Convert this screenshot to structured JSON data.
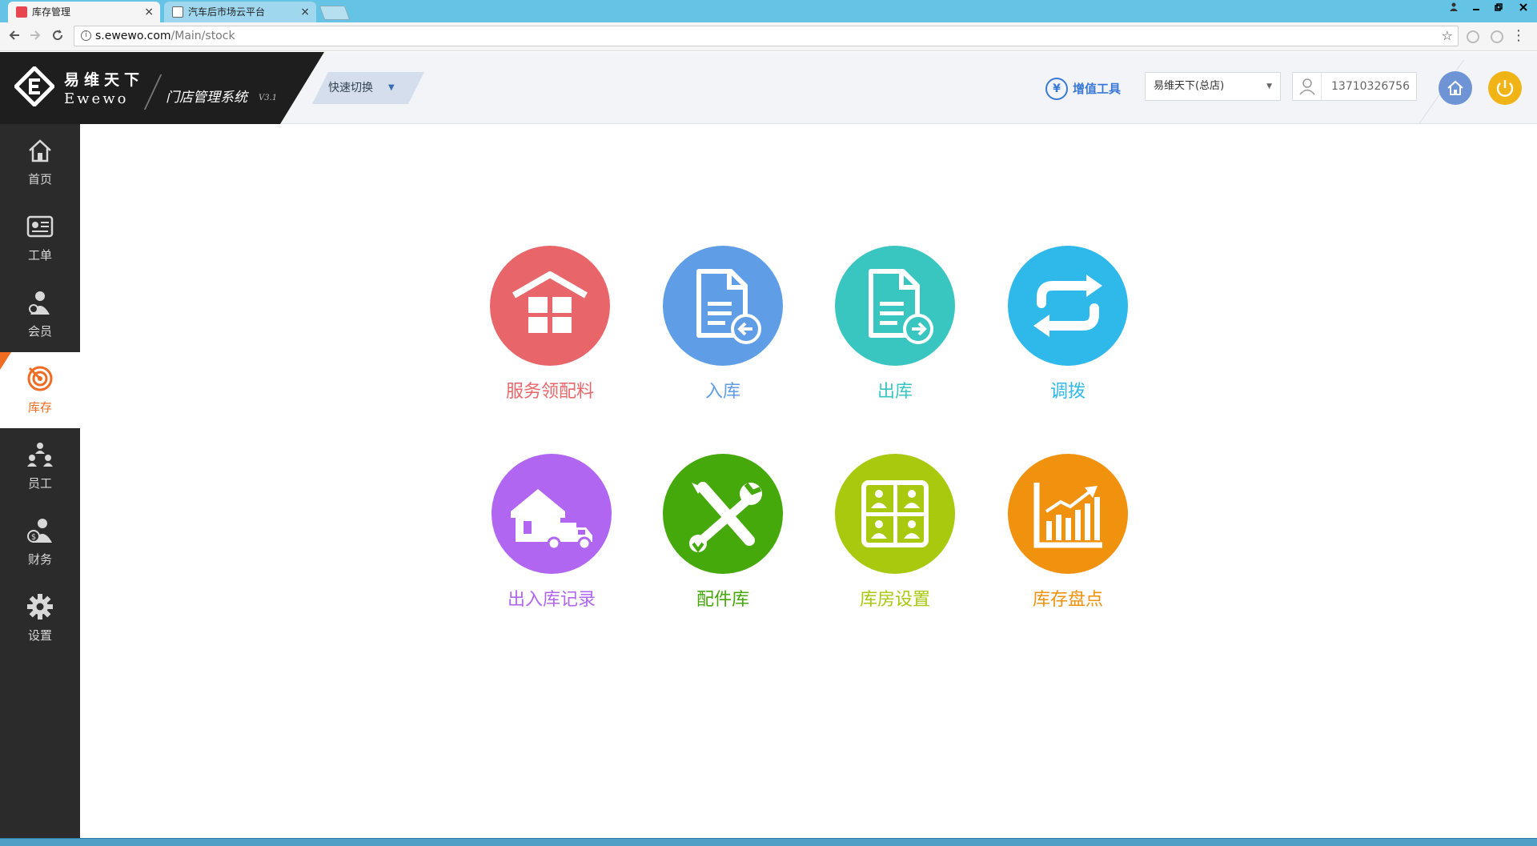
{
  "browser": {
    "tabs": [
      {
        "title": "库存管理",
        "active": true
      },
      {
        "title": "汽车后市场云平台",
        "active": false
      }
    ],
    "url_host": "s.ewewo.com",
    "url_path": "/Main/stock",
    "close_glyph": "×"
  },
  "header": {
    "brand_cn": "易维天下",
    "brand_en": "Ewewo",
    "system_name": "门店管理系统",
    "version": "V3.1",
    "quick_switch": "快速切换",
    "value_added_tools": "增值工具",
    "yen_symbol": "¥",
    "store": "易维天下(总店)",
    "phone": "13710326756",
    "icons": [
      "ewewo-logo-icon",
      "yen-icon",
      "user-icon",
      "home-icon",
      "power-icon"
    ],
    "colors": {
      "home": "#6f94d5",
      "power": "#f1b417",
      "accent": "#3a7ad6"
    }
  },
  "sidebar": {
    "items": [
      {
        "label": "首页",
        "icon": "home-icon",
        "active": false
      },
      {
        "label": "工单",
        "icon": "work-order-icon",
        "active": false
      },
      {
        "label": "会员",
        "icon": "member-icon",
        "active": false
      },
      {
        "label": "库存",
        "icon": "stock-target-icon",
        "active": true
      },
      {
        "label": "员工",
        "icon": "staff-icon",
        "active": false
      },
      {
        "label": "财务",
        "icon": "finance-icon",
        "active": false
      },
      {
        "label": "设置",
        "icon": "gear-icon",
        "active": false
      }
    ],
    "active_color": "#f06c22"
  },
  "tiles": [
    {
      "label": "服务领配料",
      "icon": "warehouse-boxes-icon",
      "color": "#e8666a"
    },
    {
      "label": "入库",
      "icon": "document-in-icon",
      "color": "#5f9de6"
    },
    {
      "label": "出库",
      "icon": "document-out-icon",
      "color": "#39c6c1"
    },
    {
      "label": "调拨",
      "icon": "transfer-cycle-icon",
      "color": "#2fb8ea"
    },
    {
      "label": "出入库记录",
      "icon": "warehouse-truck-icon",
      "color": "#b066f0"
    },
    {
      "label": "配件库",
      "icon": "tools-icon",
      "color": "#45a80b"
    },
    {
      "label": "库房设置",
      "icon": "storeroom-grid-icon",
      "color": "#a8c90e"
    },
    {
      "label": "库存盘点",
      "icon": "stock-chart-icon",
      "color": "#f1920f"
    }
  ]
}
